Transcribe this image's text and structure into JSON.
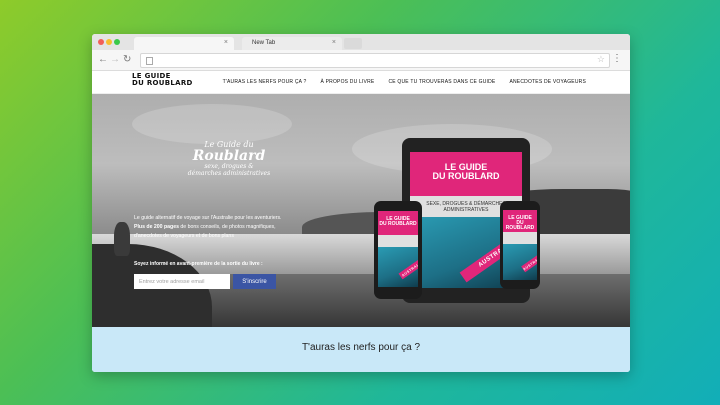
{
  "browser": {
    "tabs": [
      {
        "title": "",
        "close": "×"
      },
      {
        "title": "New Tab",
        "close": "×"
      }
    ],
    "nav": {
      "back": "←",
      "forward": "→",
      "reload": "↻"
    },
    "star": "☆",
    "menu": "⋮"
  },
  "site": {
    "logo": {
      "line1": "LE GUIDE",
      "line2": "DU ROUBLARD"
    },
    "nav": [
      "T'AURAS LES NERFS POUR ÇA ?",
      "À PROPOS DU LIVRE",
      "CE QUE TU TROUVERAS DANS CE GUIDE",
      "ANECDOTES DE VOYAGEURS"
    ]
  },
  "hero": {
    "logo": {
      "line1": "Le Guide du",
      "line2": "Roublard",
      "line3": "sexe, drogues &",
      "line4": "démarches administratives"
    },
    "intro": {
      "line1": "Le guide alternatif de voyage sur l'Australie pour les aventuriers.",
      "bold": "Plus de 200 pages",
      "line2_rest": " de bons conseils, de photos magnifiques,",
      "line3": "d'anecdotes de voyageurs et de bons plans"
    },
    "cta_label": "Soyez informé en avant-première de la sortie du livre :",
    "email_placeholder": "Entrez votre adresse email",
    "subscribe_label": "S'inscrire",
    "cover": {
      "title_line1": "LE GUIDE",
      "title_line2": "DU ROUBLARD",
      "subtitle": "SEXE, DROGUES & DÉMARCHES ADMINISTRATIVES",
      "ribbon": "AUSTRALIE"
    }
  },
  "section": {
    "title": "T'auras les nerfs pour ça ?"
  },
  "colors": {
    "accent": "#3b55a4",
    "cover_pink": "#e0267a",
    "section_bg": "#c9e8f8"
  }
}
